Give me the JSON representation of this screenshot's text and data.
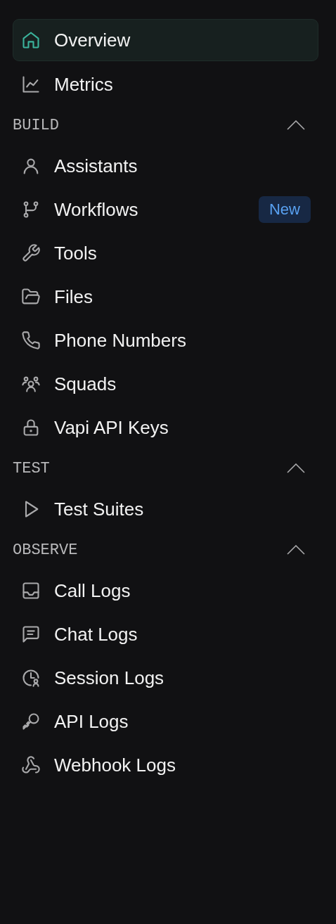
{
  "nav": [
    {
      "label": "Overview",
      "kind": "home",
      "selected": true
    },
    {
      "label": "Metrics",
      "kind": "chart",
      "selected": false
    }
  ],
  "sections": [
    {
      "title": "BUILD",
      "expanded": true,
      "items": [
        {
          "label": "Assistants",
          "kind": "user",
          "selected": false
        },
        {
          "label": "Workflows",
          "kind": "branch",
          "selected": false,
          "badge": "New"
        },
        {
          "label": "Tools",
          "kind": "wrench",
          "selected": false
        },
        {
          "label": "Files",
          "kind": "folder",
          "selected": false
        },
        {
          "label": "Phone Numbers",
          "kind": "phone",
          "selected": false
        },
        {
          "label": "Squads",
          "kind": "users",
          "selected": false
        },
        {
          "label": "Vapi API Keys",
          "kind": "lock",
          "selected": false
        }
      ]
    },
    {
      "title": "TEST",
      "expanded": true,
      "items": [
        {
          "label": "Test Suites",
          "kind": "play",
          "selected": false
        }
      ]
    },
    {
      "title": "OBSERVE",
      "expanded": true,
      "items": [
        {
          "label": "Call Logs",
          "kind": "inbox",
          "selected": false
        },
        {
          "label": "Chat Logs",
          "kind": "message",
          "selected": false
        },
        {
          "label": "Session Logs",
          "kind": "clock",
          "selected": false
        },
        {
          "label": "API Logs",
          "kind": "key",
          "selected": false
        },
        {
          "label": "Webhook Logs",
          "kind": "webhook",
          "selected": false
        }
      ]
    }
  ]
}
